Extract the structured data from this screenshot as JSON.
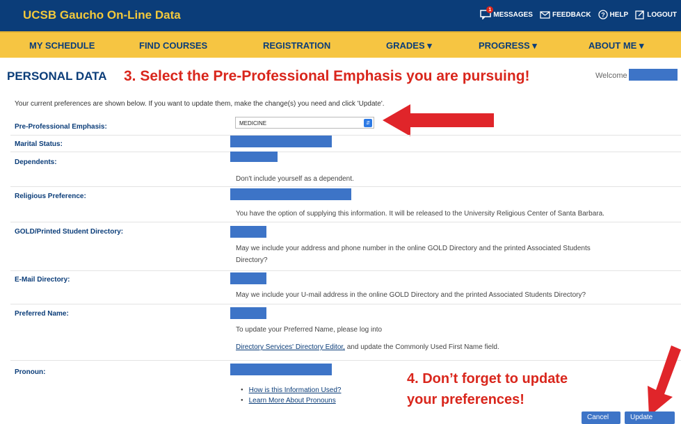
{
  "header": {
    "app_title": "UCSB Gaucho On-Line Data",
    "links": [
      {
        "label": "MESSAGES",
        "icon": "message-icon",
        "badge": "1"
      },
      {
        "label": "FEEDBACK",
        "icon": "mail-icon"
      },
      {
        "label": "HELP",
        "icon": "help-icon"
      },
      {
        "label": "LOGOUT",
        "icon": "logout-icon"
      }
    ]
  },
  "nav": {
    "items": [
      {
        "label": "MY SCHEDULE"
      },
      {
        "label": "FIND COURSES"
      },
      {
        "label": "REGISTRATION"
      },
      {
        "label": "GRADES ▾"
      },
      {
        "label": "PROGRESS ▾"
      },
      {
        "label": "ABOUT ME ▾"
      }
    ]
  },
  "page": {
    "title": "PERSONAL DATA",
    "welcome": "Welcome",
    "intro": "Your current preferences are shown below. If you want to update them, make the change(s) you need and click 'Update'."
  },
  "annotations": {
    "step3": "3. Select the Pre-Professional Emphasis you are pursuing!",
    "step4_line1": "4. Don’t forget to update",
    "step4_line2": "your preferences!"
  },
  "form": {
    "emphasis": {
      "label": "Pre-Professional Emphasis:",
      "value": "MEDICINE"
    },
    "marital": {
      "label": "Marital Status:"
    },
    "dependents": {
      "label": "Dependents:",
      "note": "Don't include yourself as a dependent."
    },
    "religious": {
      "label": "Religious Preference:",
      "note": "You have the option of supplying this information. It will be released to the University Religious Center of Santa Barbara."
    },
    "directory": {
      "label": "GOLD/Printed Student Directory:",
      "note_line1": "May we include your address and phone number in the online GOLD Directory and the printed Associated Students",
      "note_line2": "Directory?"
    },
    "email_dir": {
      "label": "E-Mail Directory:",
      "note": "May we include your U-mail address in the online GOLD Directory and the printed Associated Students Directory?"
    },
    "preferred": {
      "label": "Preferred Name:",
      "note_line1": "To update your Preferred Name, please log into",
      "link": "Directory Services' Directory Editor,",
      "note_line2_rest": " and update the Commonly Used First Name field."
    },
    "pronoun": {
      "label": "Pronoun:",
      "link1": "How is this Information Used?",
      "link2": "Learn More About Pronouns"
    }
  },
  "buttons": {
    "cancel": "Cancel",
    "update": "Update"
  },
  "colors": {
    "navy": "#0b3d79",
    "gold": "#f6c542",
    "redaction_blue": "#3d74c7",
    "annotation_red": "#d9261c"
  }
}
